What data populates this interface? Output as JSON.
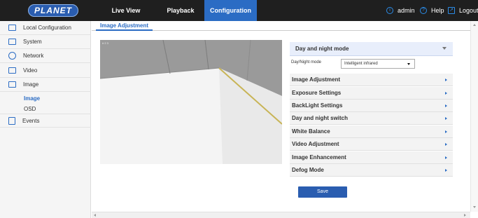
{
  "header": {
    "logo": "PLANET",
    "nav": [
      "Live View",
      "Playback",
      "Configuration"
    ],
    "active_nav": "Configuration",
    "user": "admin",
    "help": "Help",
    "logout": "Logout"
  },
  "sidebar": {
    "items": [
      {
        "label": "Local Configuration",
        "icon": "monitor-icon"
      },
      {
        "label": "System",
        "icon": "window-icon"
      },
      {
        "label": "Network",
        "icon": "globe-icon"
      },
      {
        "label": "Video",
        "icon": "film-icon"
      },
      {
        "label": "Image",
        "icon": "picture-icon"
      }
    ],
    "sub_items": [
      {
        "label": "Image",
        "active": true
      },
      {
        "label": "OSD",
        "active": false
      }
    ],
    "events": {
      "label": "Events",
      "icon": "document-icon"
    }
  },
  "main": {
    "tab": "Image Adjustment",
    "video": {
      "stamp": "# 2 3"
    },
    "day_night_section": {
      "title": "Day and night mode",
      "field_label": "Day/Night mode",
      "field_value": "Intelligent infrared"
    },
    "accordion": [
      "Image Adjustment",
      "Exposure Settings",
      "BackLight Settings",
      "Day and night switch",
      "White Balance",
      "Video Adjustment",
      "Image Enhancement",
      "Defog Mode"
    ],
    "save_label": "Save"
  },
  "colors": {
    "topbar": "#1f1f1f",
    "accent": "#2b6cc4",
    "panel_head": "#e8eefb"
  }
}
